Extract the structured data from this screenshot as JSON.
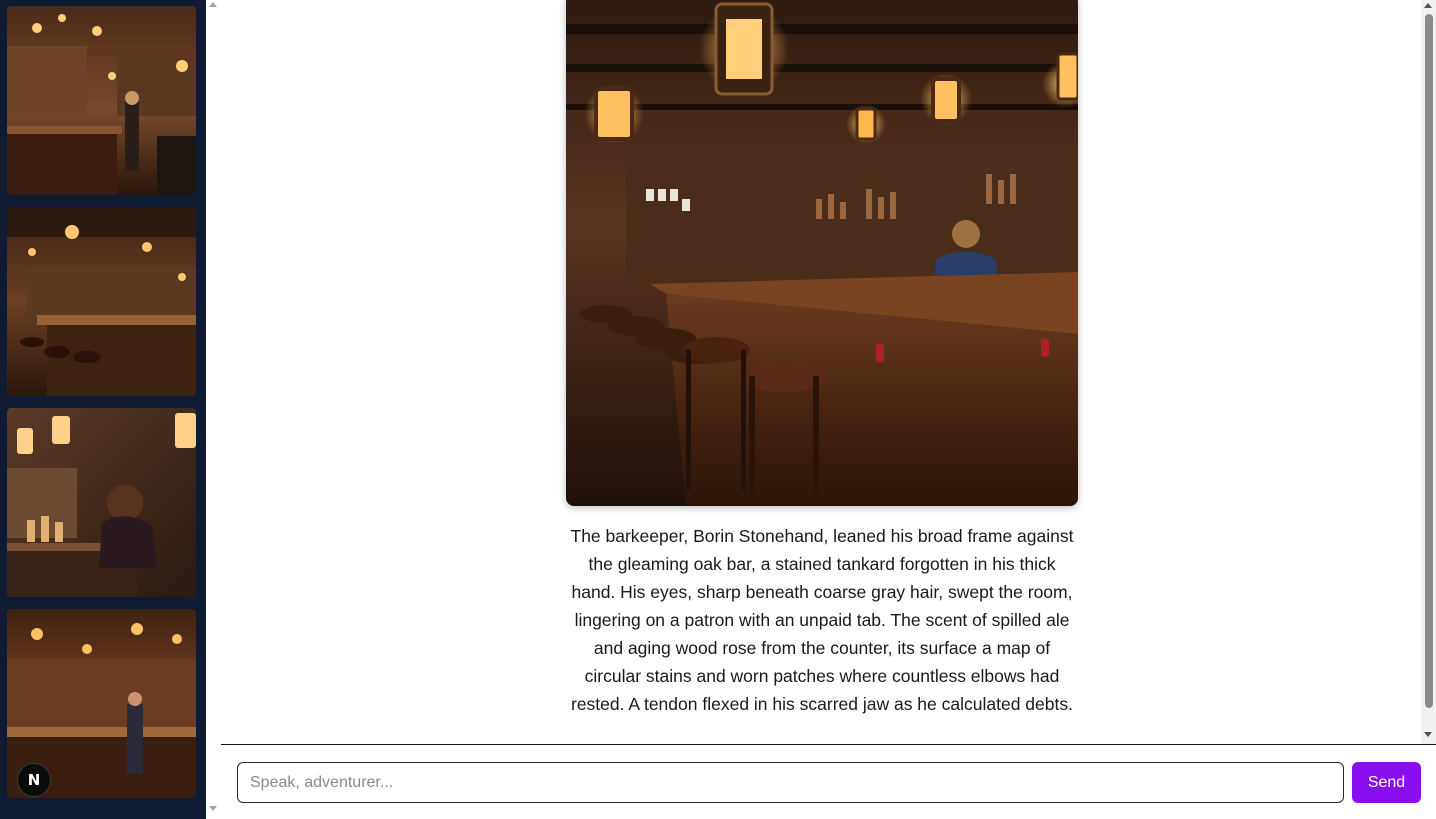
{
  "sidebar": {
    "thumbnails": [
      {
        "icon": "tavern-scene-image"
      },
      {
        "icon": "tavern-bar-image"
      },
      {
        "icon": "tavern-patron-image"
      },
      {
        "icon": "tavern-interior-image"
      }
    ],
    "badge": {
      "label": "N",
      "icon": "n-logo-icon"
    }
  },
  "main": {
    "scene_image": {
      "icon": "barkeeper-tavern-image"
    },
    "story_text": "The barkeeper, Borin Stonehand, leaned his broad frame against the gleaming oak bar, a stained tankard forgotten in his thick hand. His eyes, sharp beneath coarse gray hair, swept the room, lingering on a patron with an unpaid tab. The scent of spilled ale and aging wood rose from the counter, its surface a map of circular stains and worn patches where countless elbows had rested. A tendon flexed in his scarred jaw as he calculated debts."
  },
  "composer": {
    "placeholder": "Speak, adventurer...",
    "value": "",
    "send_label": "Send"
  },
  "colors": {
    "sidebar_bg": "#0f1b33",
    "send_button": "#8a0ff0",
    "text": "#1a1a1a"
  }
}
